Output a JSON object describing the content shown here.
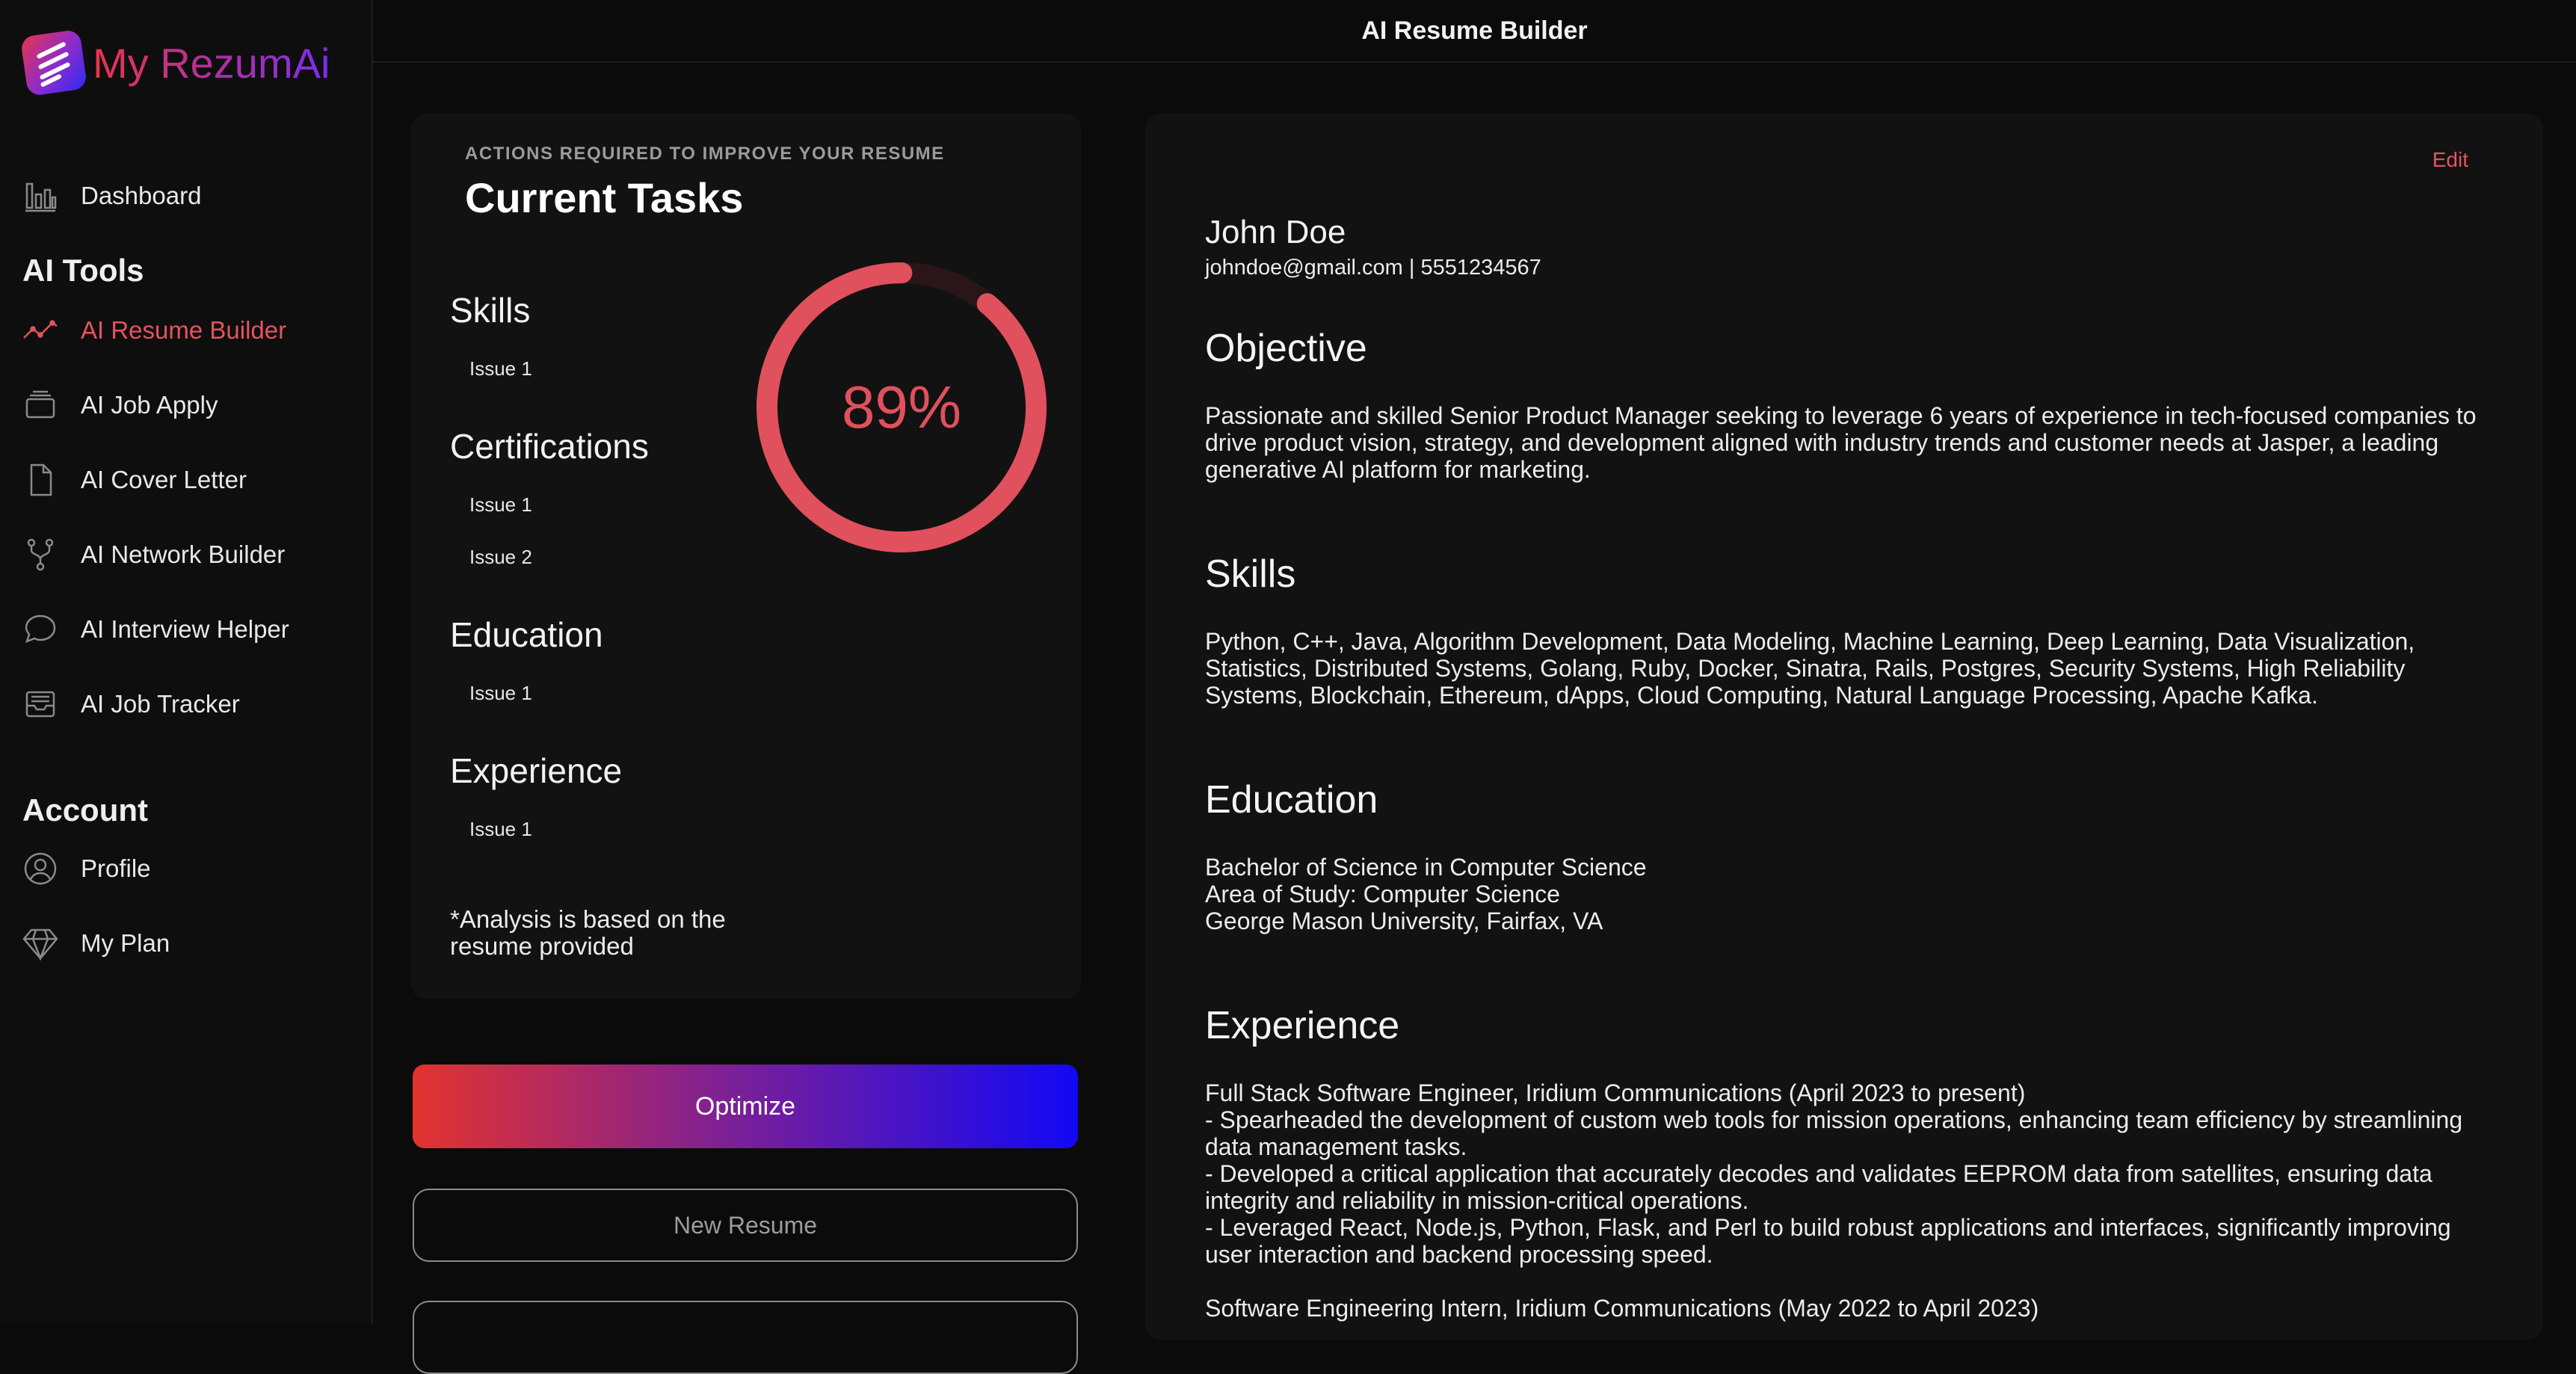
{
  "app": {
    "name": "My RezumAi",
    "page_title": "AI Resume Builder"
  },
  "sidebar": {
    "dashboard": "Dashboard",
    "ai_tools_heading": "AI Tools",
    "tools": [
      {
        "label": "AI Resume Builder",
        "icon": "trend-line-icon",
        "active": true
      },
      {
        "label": "AI Job Apply",
        "icon": "cards-stack-icon"
      },
      {
        "label": "AI Cover Letter",
        "icon": "document-icon"
      },
      {
        "label": "AI Network Builder",
        "icon": "git-fork-icon"
      },
      {
        "label": "AI Interview Helper",
        "icon": "chat-bubble-icon"
      },
      {
        "label": "AI Job Tracker",
        "icon": "inbox-tray-icon"
      }
    ],
    "account_heading": "Account",
    "account": [
      {
        "label": "Profile",
        "icon": "user-circle-icon"
      },
      {
        "label": "My Plan",
        "icon": "diamond-icon"
      }
    ]
  },
  "tasks": {
    "overline": "ACTIONS REQUIRED TO IMPROVE YOUR RESUME",
    "title": "Current Tasks",
    "categories": [
      {
        "name": "Skills",
        "issues": [
          "Issue 1"
        ]
      },
      {
        "name": "Certifications",
        "issues": [
          "Issue 1",
          "Issue 2"
        ]
      },
      {
        "name": "Education",
        "issues": [
          "Issue 1"
        ]
      },
      {
        "name": "Experience",
        "issues": [
          "Issue 1"
        ]
      }
    ],
    "score_percent": 89,
    "score_label": "89%",
    "note": "*Analysis is based on the resume provided"
  },
  "actions": {
    "optimize": "Optimize",
    "new_resume": "New Resume"
  },
  "resume": {
    "edit": "Edit",
    "name": "John Doe",
    "contact": "johndoe@gmail.com | 5551234567",
    "objective_heading": "Objective",
    "objective": "Passionate and skilled Senior Product Manager seeking to leverage 6 years of experience in tech-focused companies to drive product vision, strategy, and development aligned with industry trends and customer needs at Jasper, a leading generative AI platform for marketing.",
    "skills_heading": "Skills",
    "skills": "Python, C++, Java, Algorithm Development, Data Modeling, Machine Learning, Deep Learning, Data Visualization, Statistics, Distributed Systems, Golang, Ruby, Docker, Sinatra, Rails, Postgres, Security Systems, High Reliability Systems, Blockchain, Ethereum, dApps, Cloud Computing, Natural Language Processing, Apache Kafka.",
    "education_heading": "Education",
    "education": "Bachelor of Science in Computer Science\nArea of Study: Computer Science\nGeorge Mason University, Fairfax, VA",
    "experience_heading": "Experience",
    "experience": "Full Stack Software Engineer, Iridium Communications (April 2023 to present)\n- Spearheaded the development of custom web tools for mission operations, enhancing team efficiency by streamlining data management tasks.\n- Developed a critical application that accurately decodes and validates EEPROM data from satellites, ensuring data integrity and reliability in mission-critical operations.\n- Leveraged React, Node.js, Python, Flask, and Perl to build robust applications and interfaces, significantly improving user interaction and backend processing speed.\n\nSoftware Engineering Intern, Iridium Communications (May 2022 to April 2023)"
  },
  "colors": {
    "accent": "#e5535f",
    "gradient_start": "#e3332f",
    "gradient_end": "#1208f5",
    "background": "#0b0b0b",
    "card": "#121212"
  }
}
